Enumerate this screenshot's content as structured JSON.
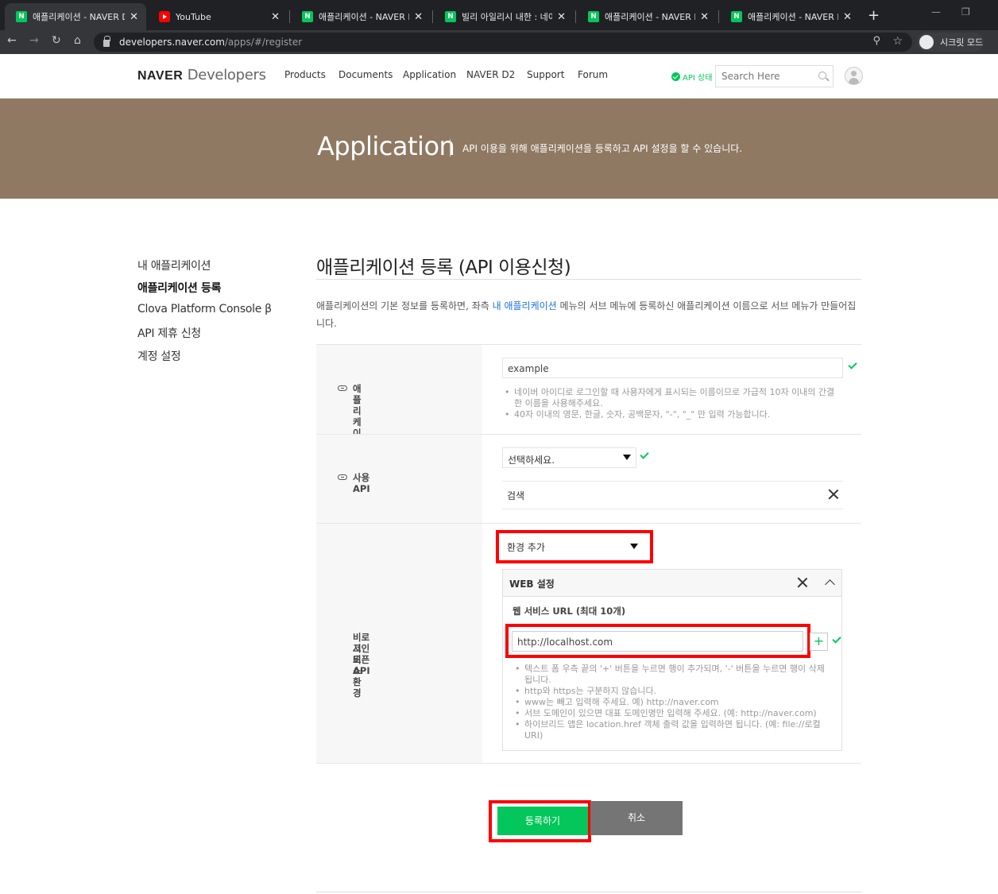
{
  "browser": {
    "tabs": [
      {
        "label": "애플리케이션 - NAVER De",
        "icon": "naver-icon",
        "active": true
      },
      {
        "label": "YouTube",
        "icon": "youtube-icon",
        "active": false
      },
      {
        "label": "애플리케이션 - NAVER De",
        "icon": "naver-icon",
        "active": false
      },
      {
        "label": "빌리 아일리시 내한 : 네이",
        "icon": "naver-icon",
        "active": false
      },
      {
        "label": "애플리케이션 - NAVER De",
        "icon": "naver-icon",
        "active": false
      },
      {
        "label": "애플리케이션 - NAVER De",
        "icon": "naver-icon",
        "active": false
      }
    ],
    "url_host": "developers.naver.com",
    "url_path": "/apps/#/register",
    "incognito_label": "시크릿 모드"
  },
  "header": {
    "logo_bold": "NAVER",
    "logo_light": "Developers",
    "nav": [
      "Products",
      "Documents",
      "Application",
      "NAVER D2",
      "Support",
      "Forum"
    ],
    "api_status": "API 상태",
    "search_placeholder": "Search Here"
  },
  "banner": {
    "title": "Application",
    "subtitle": "API 이용을 위해 애플리케이션을 등록하고 API 설정을 할 수 있습니다."
  },
  "sidebar": {
    "items": [
      {
        "label": "내 애플리케이션",
        "active": false
      },
      {
        "label": "애플리케이션 등록",
        "active": true
      },
      {
        "label": "Clova Platform Console β",
        "active": false
      },
      {
        "label": "API 제휴 신청",
        "active": false
      },
      {
        "label": "계정 설정",
        "active": false
      }
    ]
  },
  "main": {
    "title": "애플리케이션 등록 (API 이용신청)",
    "desc_before": "애플리케이션의 기본 정보를 등록하면, 좌측 ",
    "desc_link": "내 애플리케이션",
    "desc_after": " 메뉴의 서브 메뉴에 등록하신 애플리케이션 이름으로 서브 메뉴가 만들어집니다.",
    "app_name": {
      "label": "애플리케이션 이름",
      "value": "example",
      "notes": [
        "네이버 아이디로 로그인할 때 사용자에게 표시되는 이름이므로 가급적 10자 이내의 간결한 이름을 사용해주세요.",
        "40자 이내의 영문, 한글, 숫자, 공백문자, \"-\", \"_\" 만 입력 가능합니다."
      ]
    },
    "use_api": {
      "label": "사용 API",
      "select_value": "선택하세요.",
      "selected_item": "검색"
    },
    "environment": {
      "label_line1": "비로그인 오픈 API",
      "label_line2": "서비스 환경",
      "select_value": "환경 추가",
      "panel_title": "WEB 설정",
      "url_label": "웹 서비스 URL (최대 10개)",
      "url_value": "http://localhost.com",
      "plus_label": "+",
      "notes": [
        "텍스트 폼 우측 끝의 '+' 버튼을 누르면 행이 추가되며, '-' 버튼을 누르면 행이 삭제됩니다.",
        "http와 https는 구분하지 않습니다.",
        "www는 빼고 입력해 주세요. 예) http://naver.com",
        "서브 도메인이 있으면 대표 도메인명만 입력해 주세요. (예: http://naver.com)",
        "하이브리드 앱은 location.href 객체 출력 값을 입력하면 됩니다. (예: file://로컬URI)"
      ]
    },
    "register_button": "등록하기",
    "cancel_button": "취소"
  },
  "colors": {
    "brand_green": "#03c75a",
    "banner_bg": "#8f7963",
    "highlight_red": "#ff0000",
    "cancel_gray": "#757575"
  }
}
